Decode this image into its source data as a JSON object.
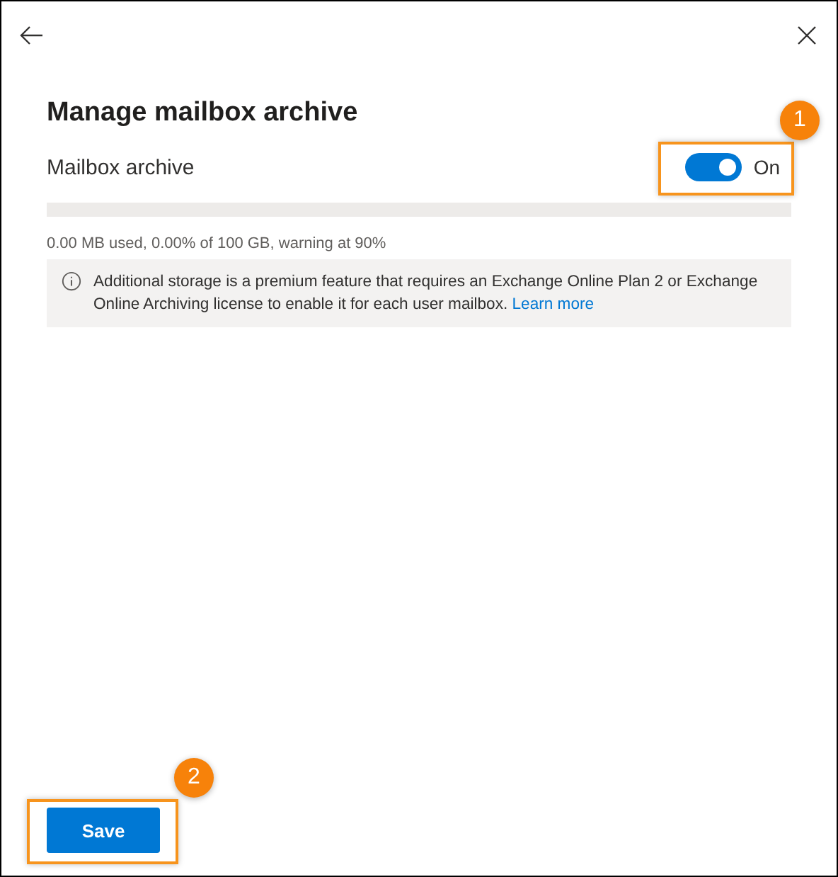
{
  "title": "Manage mailbox archive",
  "archive": {
    "label": "Mailbox archive",
    "on": true,
    "state_label": "On",
    "callout": "1"
  },
  "usage": {
    "level": 0,
    "text": "0.00 MB used, 0.00% of 100 GB, warning at 90%"
  },
  "info": {
    "text": "Additional storage is a premium feature that requires an Exchange Online Plan 2 or Exchange Online Archiving license to enable it for each user mailbox.",
    "link": "Learn more"
  },
  "save": {
    "label": "Save",
    "callout": "2"
  }
}
